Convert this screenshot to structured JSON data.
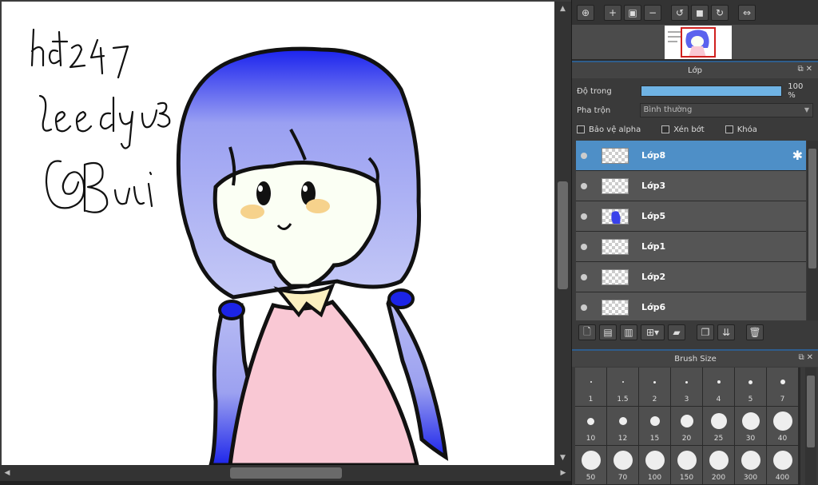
{
  "canvas": {
    "handwriting_lines": [
      "hd247",
      "leedyu3",
      "@Bui"
    ]
  },
  "navigator_toolbar": {
    "buttons": [
      "zoom-fit-icon",
      "zoom-in-icon",
      "fit-window-icon",
      "zoom-out-icon",
      "rotate-left-icon",
      "reset-view-icon",
      "rotate-right-icon",
      "flip-icon"
    ]
  },
  "layer_panel": {
    "title": "Lớp",
    "opacity_label": "Độ trong",
    "opacity_value": "100 %",
    "opacity_fraction": 1.0,
    "blend_label": "Pha trộn",
    "blend_value": "Bình thường",
    "protect_alpha": "Bảo vệ alpha",
    "clipping": "Xén bớt",
    "lock": "Khóa",
    "layers": [
      {
        "name": "Lớp8",
        "selected": true
      },
      {
        "name": "Lớp3",
        "selected": false
      },
      {
        "name": "Lớp5",
        "selected": false
      },
      {
        "name": "Lớp1",
        "selected": false
      },
      {
        "name": "Lớp2",
        "selected": false
      },
      {
        "name": "Lớp6",
        "selected": false
      }
    ]
  },
  "brush_panel": {
    "title": "Brush Size",
    "sizes": [
      "1",
      "1.5",
      "2",
      "3",
      "4",
      "5",
      "7",
      "10",
      "12",
      "15",
      "20",
      "25",
      "30",
      "40",
      "50",
      "70",
      "100",
      "150",
      "200",
      "300",
      "400"
    ]
  },
  "colors": {
    "accent": "#4e8fc7",
    "hair": "#2a32e8",
    "dress": "#f9c8d4"
  }
}
